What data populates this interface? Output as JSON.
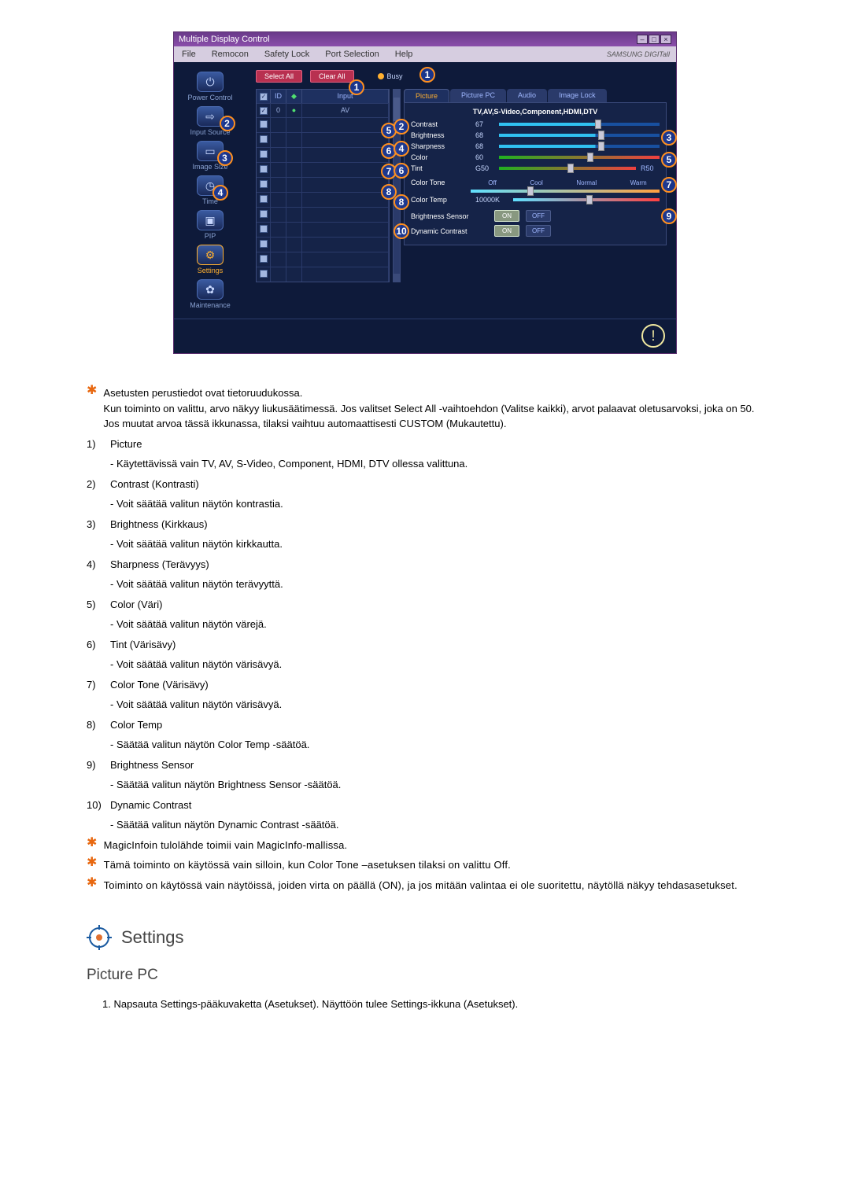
{
  "app": {
    "title": "Multiple Display Control",
    "menu": [
      "File",
      "Remocon",
      "Safety Lock",
      "Port Selection",
      "Help"
    ],
    "brand": "SAMSUNG DIGITall",
    "sidebar": [
      {
        "label": "Power Control"
      },
      {
        "label": "Input Source"
      },
      {
        "label": "Image Size"
      },
      {
        "label": "Time"
      },
      {
        "label": "PIP"
      },
      {
        "label": "Settings"
      },
      {
        "label": "Maintenance"
      }
    ],
    "select_all": "Select All",
    "clear_all": "Clear All",
    "busy": "Busy",
    "grid": {
      "headers": {
        "id": "ID",
        "input": "Input"
      },
      "first_row": {
        "id": "0",
        "input": "AV"
      }
    },
    "tabs": [
      "Picture",
      "Picture PC",
      "Audio",
      "Image Lock"
    ],
    "panel_title": "TV,AV,S-Video,Component,HDMI,DTV",
    "controls": {
      "contrast": {
        "label": "Contrast",
        "value": "67"
      },
      "brightness": {
        "label": "Brightness",
        "value": "68"
      },
      "sharpness": {
        "label": "Sharpness",
        "value": "68"
      },
      "color": {
        "label": "Color",
        "value": "60"
      },
      "tint": {
        "label": "Tint",
        "left": "G50",
        "right": "R50"
      },
      "color_tone": {
        "label": "Color Tone",
        "options": [
          "Off",
          "Cool",
          "Normal",
          "Warm"
        ]
      },
      "color_temp": {
        "label": "Color Temp",
        "value": "10000K"
      },
      "brightness_sensor": {
        "label": "Brightness Sensor",
        "on": "ON",
        "off": "OFF"
      },
      "dynamic_contrast": {
        "label": "Dynamic Contrast",
        "on": "ON",
        "off": "OFF"
      }
    },
    "callouts": {
      "side_2": "2",
      "side_3": "3",
      "side_4": "4",
      "top_1": "1",
      "grid_5": "5",
      "grid_6": "6",
      "grid_7": "7",
      "grid_8": "8",
      "tab_1": "1",
      "panel_2": "2",
      "panel_3": "3",
      "panel_4": "4",
      "panel_5": "5",
      "panel_6": "6",
      "panel_7": "7",
      "panel_8": "8",
      "panel_9": "9",
      "panel_10": "10"
    }
  },
  "doc": {
    "star1a": "Asetusten perustiedot ovat tietoruudukossa.",
    "star1b": "Kun toiminto on valittu, arvo näkyy liukusäätimessä. Jos valitset Select All -vaihtoehdon (Valitse kaikki), arvot palaavat oletusarvoksi, joka on 50. Jos muutat arvoa tässä ikkunassa, tilaksi vaihtuu automaattisesti CUSTOM (Mukautettu).",
    "items": [
      {
        "n": "1)",
        "t": "Picture",
        "s": "- Käytettävissä vain TV, AV, S-Video, Component, HDMI, DTV ollessa valittuna."
      },
      {
        "n": "2)",
        "t": "Contrast (Kontrasti)",
        "s": "- Voit säätää valitun näytön kontrastia."
      },
      {
        "n": "3)",
        "t": "Brightness (Kirkkaus)",
        "s": "- Voit säätää valitun näytön kirkkautta."
      },
      {
        "n": "4)",
        "t": "Sharpness (Terävyys)",
        "s": "- Voit säätää valitun näytön terävyyttä."
      },
      {
        "n": "5)",
        "t": "Color (Väri)",
        "s": "- Voit säätää valitun näytön värejä."
      },
      {
        "n": "6)",
        "t": "Tint (Värisävy)",
        "s": "- Voit säätää valitun näytön värisävyä."
      },
      {
        "n": "7)",
        "t": "Color Tone (Värisävy)",
        "s": "- Voit säätää valitun näytön värisävyä."
      },
      {
        "n": "8)",
        "t": "Color Temp",
        "s": "- Säätää valitun näytön Color Temp -säätöä."
      },
      {
        "n": "9)",
        "t": "Brightness Sensor",
        "s": "- Säätää valitun näytön Brightness Sensor -säätöä."
      },
      {
        "n": "10)",
        "t": "Dynamic Contrast",
        "s": "- Säätää valitun näytön Dynamic Contrast -säätöä."
      }
    ],
    "star2": "MagicInfoin tulolähde toimii vain MagicInfo-mallissa.",
    "star3": "Tämä toiminto on käytössä vain silloin, kun Color Tone –asetuksen tilaksi on valittu Off.",
    "star4": "Toiminto on käytössä vain näytöissä, joiden virta on päällä (ON), ja jos mitään valintaa ei ole suoritettu, näytöllä näkyy tehdasasetukset.",
    "settings_heading": "Settings",
    "picpc_heading": "Picture PC",
    "step1": "1.  Napsauta Settings-pääkuvaketta (Asetukset). Näyttöön tulee Settings-ikkuna (Asetukset)."
  }
}
